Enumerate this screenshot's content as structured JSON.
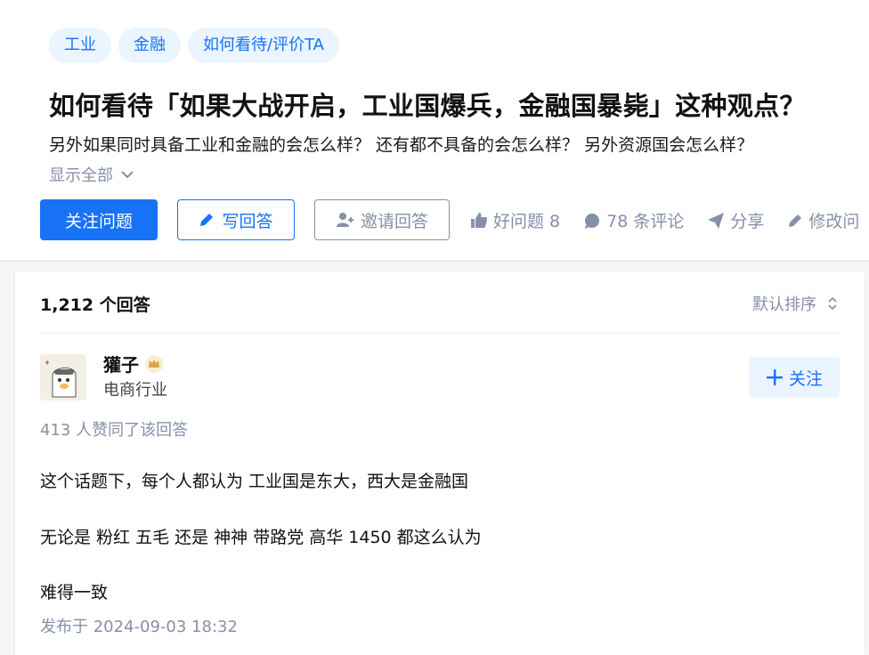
{
  "question": {
    "tags": [
      "工业",
      "金融",
      "如何看待/评价TA"
    ],
    "title": "如何看待「如果大战开启，工业国爆兵，金融国暴毙」这种观点？",
    "detail": "另外如果同时具备工业和金融的会怎么样？ 还有都不具备的会怎么样？ 另外资源国会怎么样？",
    "show_all": "显示全部",
    "follow_label": "关注问题",
    "write_label": "写回答",
    "invite_label": "邀请回答",
    "good_question": "好问题 8",
    "comments": "78 条评论",
    "share": "分享",
    "edit": "修改问"
  },
  "answers": {
    "count_label": "1,212 个回答",
    "sort_label": "默认排序",
    "item": {
      "author_name": "獾子",
      "author_desc": "电商行业",
      "follow_label": "关注",
      "votes": "413 人赞同了该回答",
      "paragraphs": [
        "这个话题下，每个人都认为 工业国是东大，西大是金融国",
        "无论是 粉红 五毛 还是 神神 带路党 高华 1450 都这么认为",
        "难得一致"
      ],
      "published": "发布于 2024-09-03 18:32"
    }
  },
  "colors": {
    "brand": "#1772f6",
    "muted": "#8590a6",
    "tag_bg": "#ebf5ff"
  }
}
